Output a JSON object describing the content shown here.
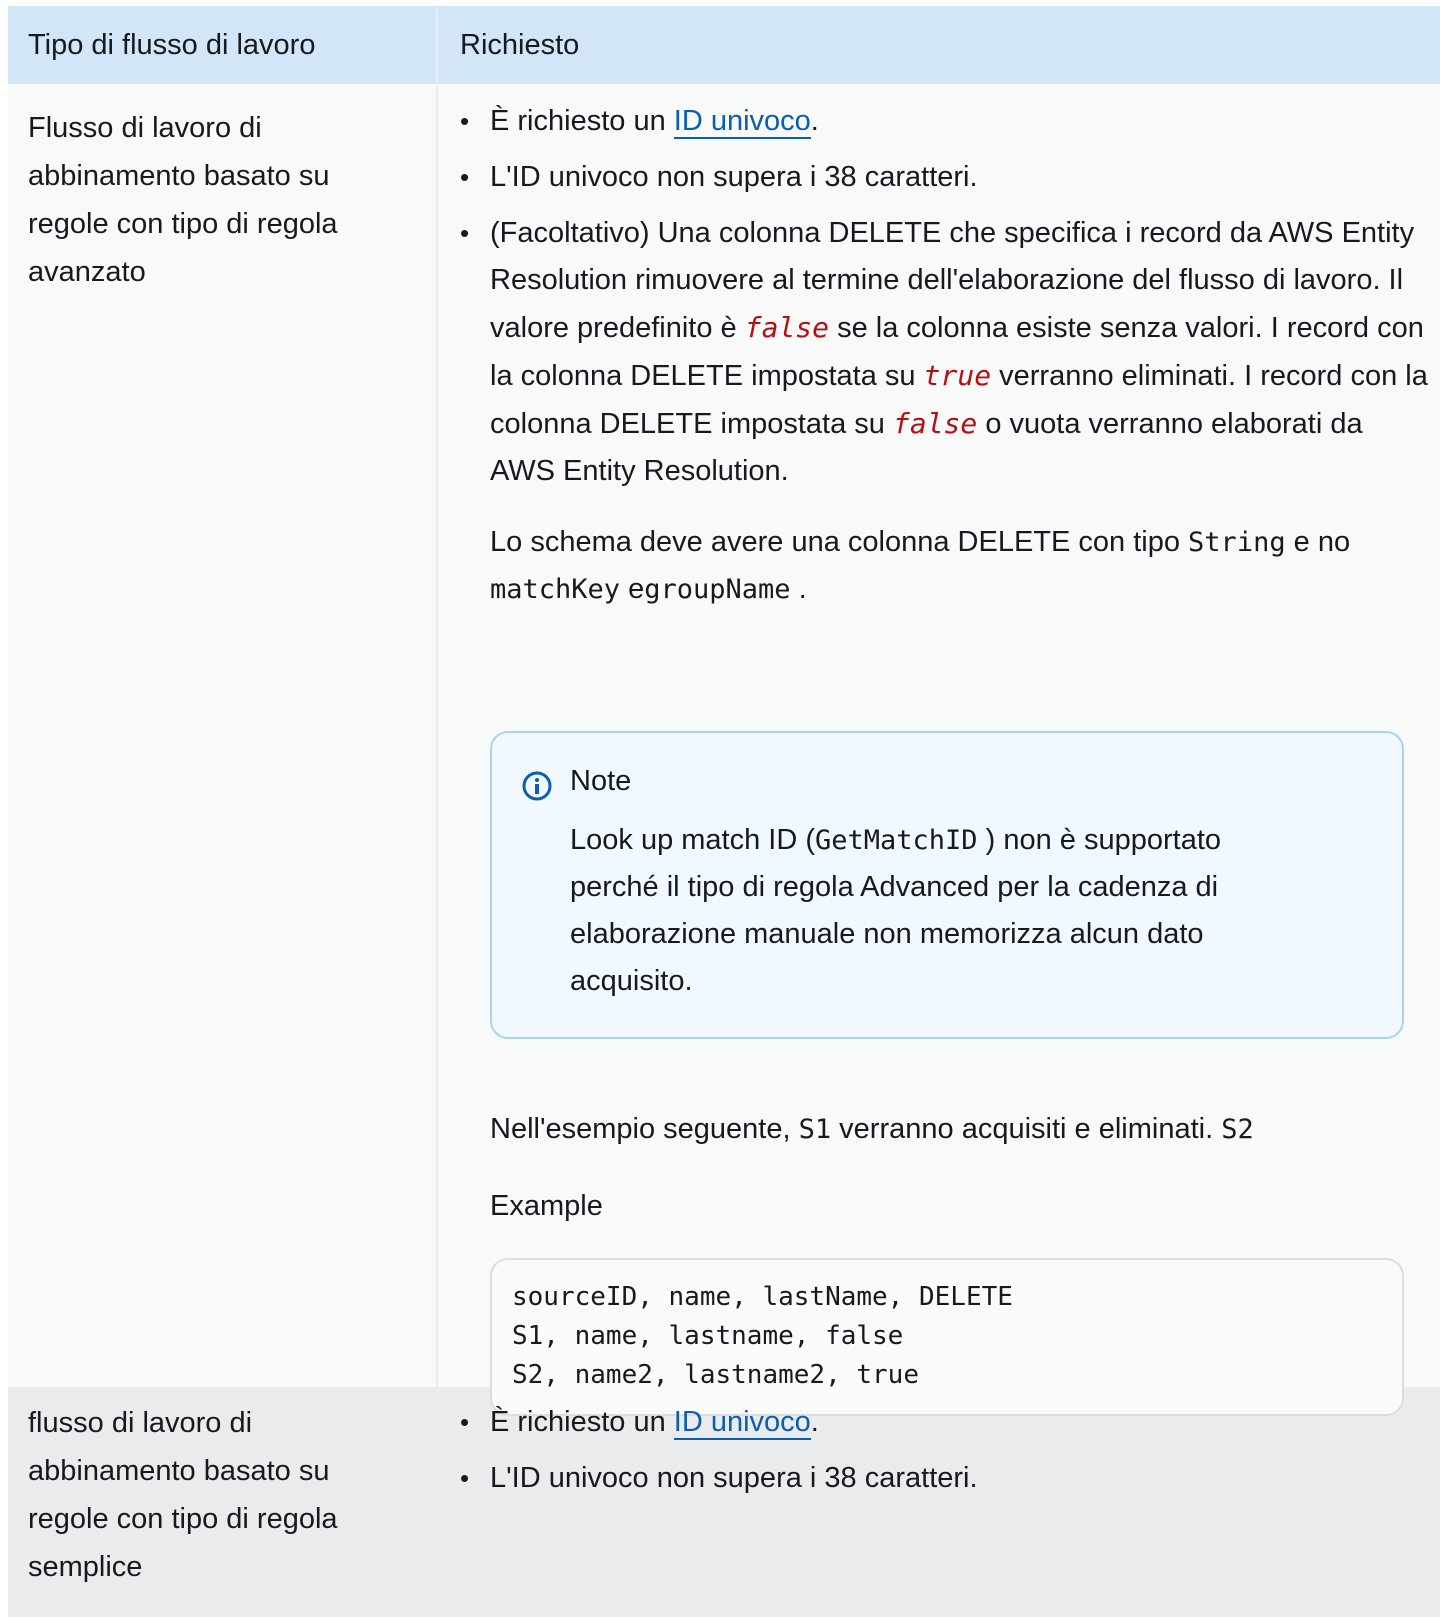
{
  "header": {
    "col1": "Tipo di flusso di lavoro",
    "col2": "Richiesto"
  },
  "rows": [
    {
      "type": "Flusso di lavoro di abbinamento basato su regole con tipo di regola avanzato",
      "bullet1_pre": "È richiesto un ",
      "bullet1_link": "ID univoco",
      "bullet1_post": ".",
      "bullet2": "L'ID univoco non supera i 38 caratteri.",
      "bullet3_a": "(Facoltativo) Una colonna DELETE che specifica i record da AWS Entity Resolution rimuovere al termine dell'elaborazione del flusso di lavoro. Il valore predefinito è ",
      "bullet3_false1": "false",
      "bullet3_b": " se la colonna esiste senza valori. I record con la colonna DELETE impostata su ",
      "bullet3_true": "true",
      "bullet3_c": " verranno eliminati. I record con la colonna DELETE impostata su ",
      "bullet3_false2": "false",
      "bullet3_d": " o vuota verranno elaborati da AWS Entity Resolution.",
      "schema_a": "Lo schema deve avere una colonna DELETE con tipo ",
      "schema_string": "String",
      "schema_b": " e no ",
      "schema_matchkey": "matchKey",
      "schema_c": " e",
      "schema_groupname": "groupName",
      "schema_d": " .",
      "note_title": "Note",
      "note_a": "Look up match ID (",
      "note_code": "GetMatchID",
      "note_b": " ) non è supportato perché il tipo di regola Advanced per la cadenza di elaborazione manuale non memorizza alcun dato acquisito.",
      "example_a": "Nell'esempio seguente, ",
      "example_s1": "S1",
      "example_b": " verranno acquisiti e eliminati. ",
      "example_s2": "S2",
      "example_label": "Example",
      "code": "sourceID, name, lastName, DELETE\nS1, name, lastname, false\nS2, name2, lastname2, true"
    },
    {
      "type": "flusso di lavoro di abbinamento basato su regole con tipo di regola semplice",
      "bullet1_pre": "È richiesto un ",
      "bullet1_link": "ID univoco",
      "bullet1_post": ".",
      "bullet2": "L'ID univoco non supera i 38 caratteri."
    }
  ],
  "colors": {
    "header_bg": "#d3e6f7",
    "link": "#0a5eb0",
    "code_red": "#b50f14",
    "note_bg": "#f1f8ff",
    "note_border": "#a7d4f3"
  },
  "icons": {
    "note": "info-circle-icon"
  }
}
